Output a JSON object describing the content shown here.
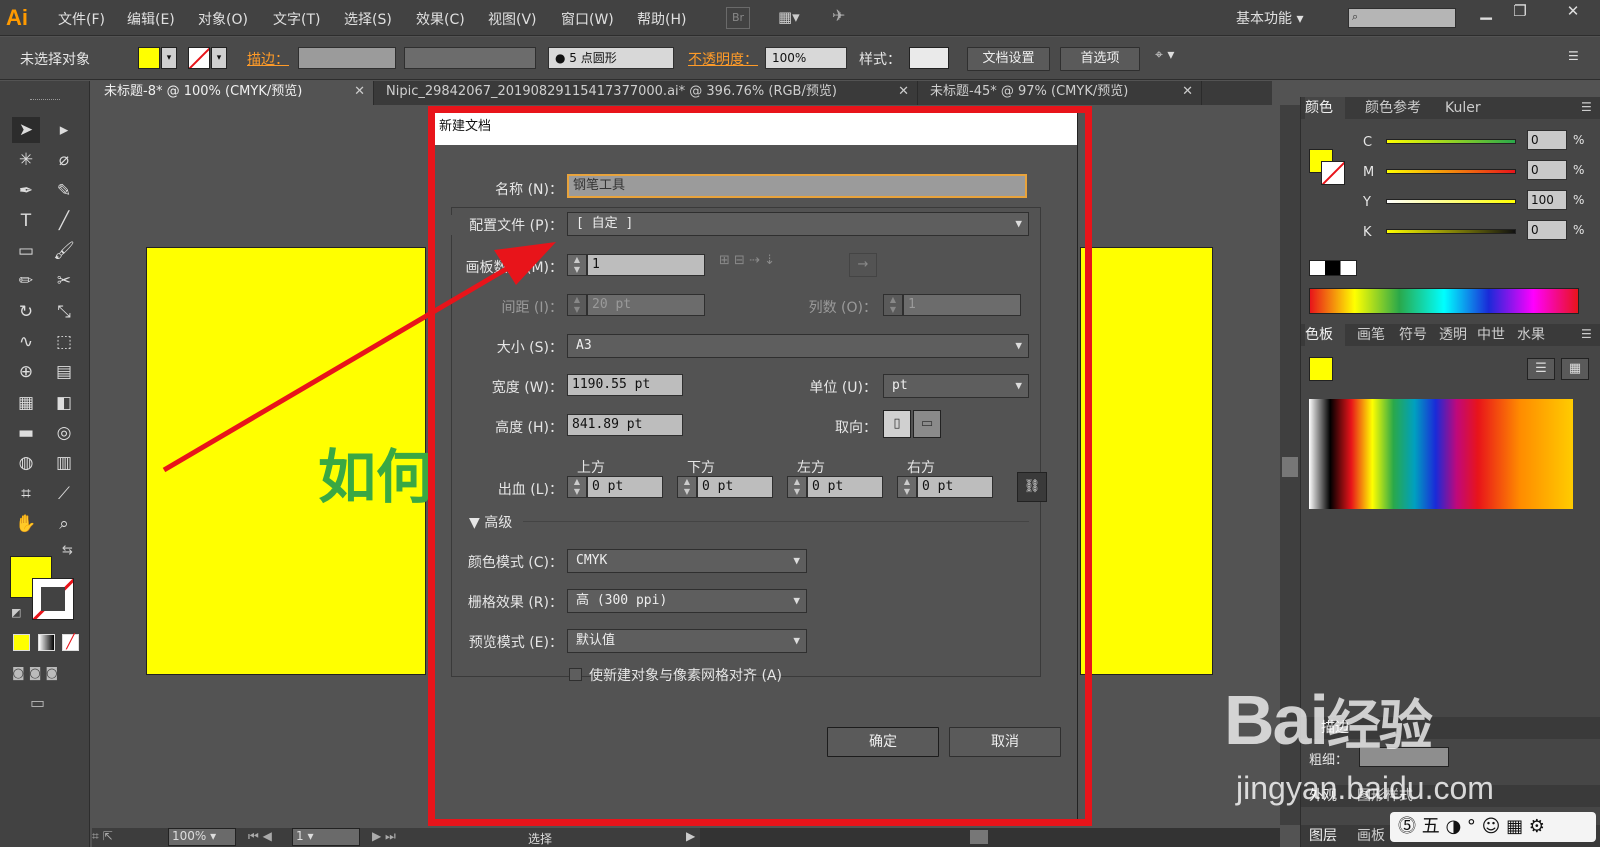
{
  "app": {
    "logo": "Ai",
    "menus": [
      "文件(F)",
      "编辑(E)",
      "对象(O)",
      "文字(T)",
      "选择(S)",
      "效果(C)",
      "视图(V)",
      "窗口(W)",
      "帮助(H)"
    ],
    "br_label": "Br",
    "workspace": "基本功能"
  },
  "control": {
    "selection": "未选择对象",
    "stroke_link": "描边：",
    "brush_label": "5 点圆形",
    "opacity_label": "不透明度：",
    "opacity_value": "100%",
    "style_label": "样式：",
    "doc_setup": "文档设置",
    "prefs": "首选项"
  },
  "tabs": [
    {
      "label": "未标题-8* @ 100% (CMYK/预览)"
    },
    {
      "label": "Nipic_29842067_20190829115417377000.ai* @ 396.76% (RGB/预览)"
    },
    {
      "label": "未标题-45* @ 97% (CMYK/预览)"
    }
  ],
  "artboard": {
    "text": "如何"
  },
  "dialog": {
    "title": "新建文档",
    "name_label": "名称 (N)：",
    "name_value": "钢笔工具",
    "profile_label": "配置文件 (P)：",
    "profile_value": "[ 自定 ]",
    "artboards_label": "画板数量 (M)：",
    "artboards_value": "1",
    "spacing_label": "间距 (I)：",
    "spacing_value": "20 pt",
    "columns_label": "列数 (O)：",
    "columns_value": "1",
    "size_label": "大小 (S)：",
    "size_value": "A3",
    "width_label": "宽度 (W)：",
    "width_value": "1190.55 pt",
    "unit_label": "单位 (U)：",
    "unit_value": "pt",
    "height_label": "高度 (H)：",
    "height_value": "841.89 pt",
    "orient_label": "取向：",
    "bleed_label": "出血 (L)：",
    "bleed_top_label": "上方",
    "bleed_bottom_label": "下方",
    "bleed_left_label": "左方",
    "bleed_right_label": "右方",
    "bleed_top": "0 pt",
    "bleed_bottom": "0 pt",
    "bleed_left": "0 pt",
    "bleed_right": "0 pt",
    "advanced_label": "高级",
    "color_mode_label": "颜色模式 (C)：",
    "color_mode_value": "CMYK",
    "raster_label": "栅格效果 (R)：",
    "raster_value": "高 (300 ppi)",
    "preview_label": "预览模式 (E)：",
    "preview_value": "默认值",
    "align_pixel_label": "使新建对象与像素网格对齐 (A)",
    "ok": "确定",
    "cancel": "取消"
  },
  "color_panel": {
    "tabs": [
      "颜色",
      "颜色参考",
      "Kuler"
    ],
    "channels": [
      {
        "name": "C",
        "value": "0"
      },
      {
        "name": "M",
        "value": "0"
      },
      {
        "name": "Y",
        "value": "100"
      },
      {
        "name": "K",
        "value": "0"
      }
    ],
    "pct": "%"
  },
  "swatch_panel": {
    "tabs": [
      "色板",
      "画笔",
      "符号",
      "透明",
      "中世",
      "水果"
    ]
  },
  "stroke_panel": {
    "label": "描边",
    "weight_label": "粗细："
  },
  "bottom_panels": {
    "tab1": "外观",
    "tab2": "图形样式",
    "tab3": "图层",
    "tab4": "画板"
  },
  "status": {
    "zoom": "100%",
    "page": "1",
    "mode": "选择"
  },
  "watermark": {
    "text1": "Bai",
    "text2": "经验",
    "url": "jingyan.baidu.com"
  },
  "colors": {
    "accent_red": "#e8141a",
    "fill_yellow": "#ffff00",
    "text_green": "#3aa843"
  }
}
